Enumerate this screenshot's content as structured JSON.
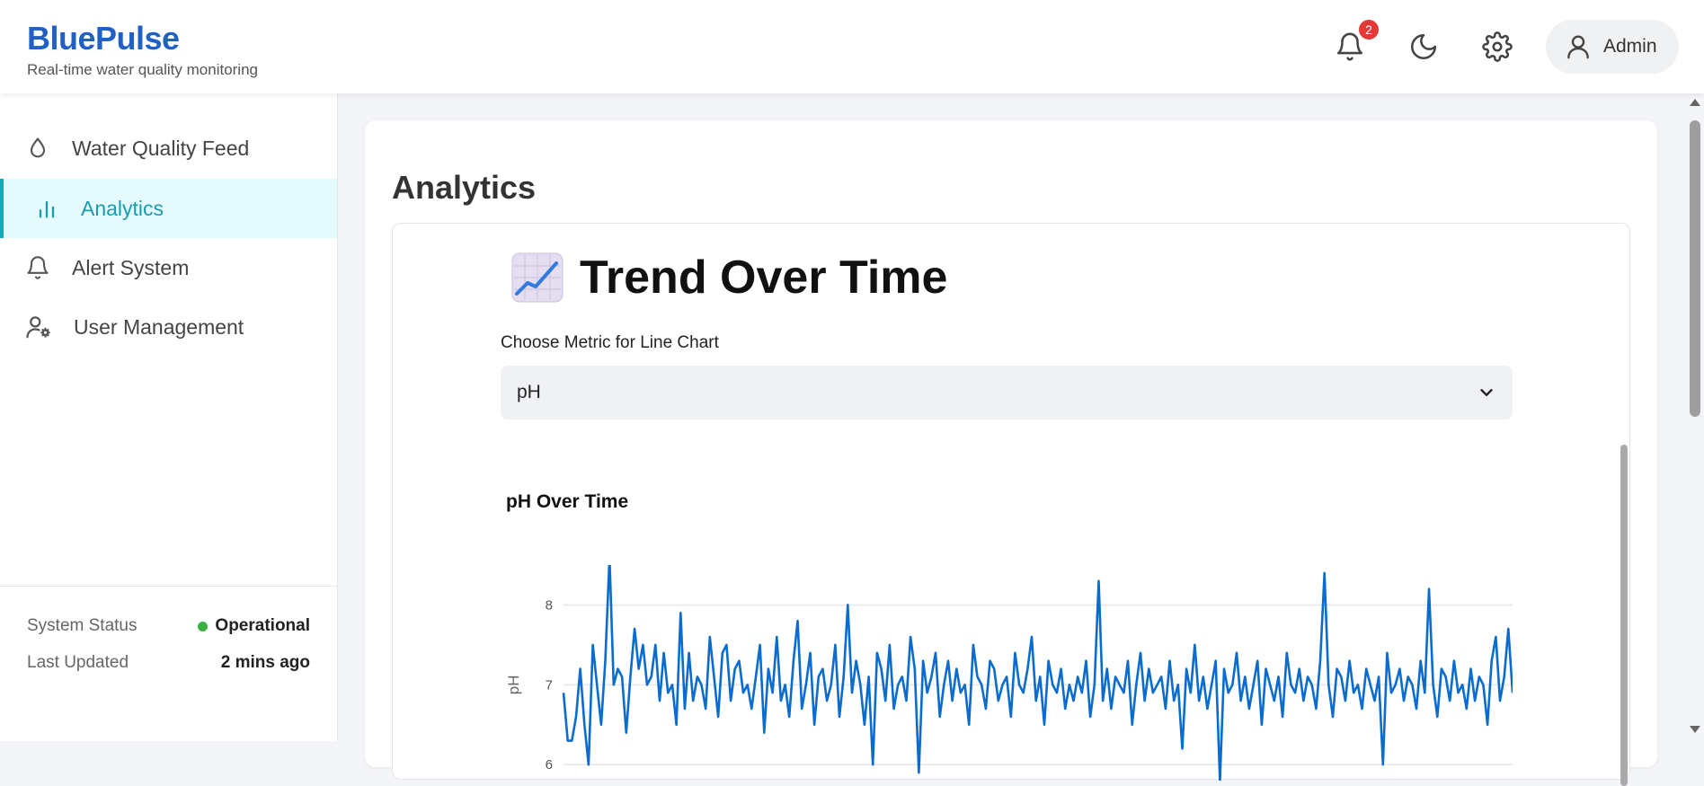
{
  "brand": {
    "name": "BluePulse",
    "tagline": "Real-time water quality monitoring"
  },
  "header": {
    "notification_count": "2",
    "user_name": "Admin",
    "icons": [
      "bell-icon",
      "moon-icon",
      "gear-icon",
      "user-icon"
    ]
  },
  "sidebar": {
    "items": [
      {
        "label": "Water Quality Feed",
        "icon": "droplet-icon",
        "active": false
      },
      {
        "label": "Analytics",
        "icon": "bar-chart-icon",
        "active": true
      },
      {
        "label": "Alert System",
        "icon": "bell-icon",
        "active": false
      },
      {
        "label": "User Management",
        "icon": "user-gear-icon",
        "active": false
      }
    ],
    "status": {
      "system_label": "System Status",
      "system_value": "Operational",
      "updated_label": "Last Updated",
      "updated_value": "2 mins ago"
    }
  },
  "main": {
    "title": "Analytics",
    "trend_heading": "Trend Over Time",
    "metric_label": "Choose Metric for Line Chart",
    "metric_value": "pH"
  },
  "colors": {
    "brand": "#2160c4",
    "accent": "#1aa5b8",
    "line": "#0a6ccf",
    "status_ok": "#3cb043",
    "badge": "#e53935"
  },
  "chart_data": {
    "type": "line",
    "title": "pH Over Time",
    "ylabel": "pH",
    "xlabel": "",
    "ylim": [
      5.8,
      8.5
    ],
    "yticks": [
      6,
      7,
      8
    ],
    "grid": true,
    "series": [
      {
        "values": [
          6.9,
          6.3,
          6.3,
          6.6,
          7.2,
          6.5,
          6.0,
          7.5,
          7.0,
          6.5,
          7.3,
          8.6,
          7.0,
          7.2,
          7.1,
          6.4,
          7.1,
          7.7,
          7.2,
          7.5,
          7.0,
          7.1,
          7.5,
          6.8,
          7.4,
          6.9,
          7.0,
          6.5,
          7.9,
          6.7,
          7.4,
          6.8,
          7.1,
          7.0,
          6.7,
          7.6,
          7.1,
          6.6,
          7.4,
          7.5,
          6.8,
          7.2,
          7.3,
          6.9,
          7.0,
          6.7,
          7.1,
          7.5,
          6.4,
          7.2,
          6.9,
          7.6,
          6.8,
          7.0,
          6.6,
          7.3,
          7.8,
          6.7,
          7.0,
          7.4,
          6.5,
          7.1,
          7.2,
          6.8,
          7.0,
          7.5,
          6.6,
          7.1,
          8.0,
          6.9,
          7.3,
          7.0,
          6.5,
          7.1,
          6.0,
          7.4,
          7.2,
          6.8,
          7.5,
          6.7,
          7.0,
          7.1,
          6.8,
          7.6,
          7.2,
          5.9,
          7.3,
          6.9,
          7.1,
          7.4,
          6.6,
          7.0,
          7.3,
          6.8,
          7.2,
          6.9,
          7.0,
          6.5,
          7.5,
          7.1,
          7.0,
          6.7,
          7.3,
          7.2,
          6.8,
          7.0,
          7.1,
          6.6,
          7.4,
          7.0,
          6.9,
          7.2,
          7.6,
          6.8,
          7.1,
          6.5,
          7.3,
          7.0,
          6.9,
          7.2,
          6.7,
          7.0,
          6.8,
          7.1,
          6.9,
          7.3,
          6.6,
          7.0,
          8.3,
          6.8,
          7.2,
          6.7,
          7.1,
          7.0,
          6.9,
          7.3,
          6.5,
          7.0,
          7.4,
          6.8,
          7.2,
          6.9,
          7.0,
          7.1,
          6.7,
          7.3,
          6.8,
          7.0,
          6.2,
          7.2,
          6.9,
          7.5,
          6.8,
          7.1,
          6.7,
          7.0,
          7.3,
          5.8,
          7.2,
          6.9,
          7.0,
          7.4,
          6.8,
          7.1,
          6.7,
          7.0,
          7.3,
          6.5,
          7.2,
          7.0,
          6.8,
          7.1,
          6.6,
          7.4,
          7.0,
          6.9,
          7.2,
          6.8,
          7.1,
          7.0,
          6.7,
          7.3,
          8.4,
          7.0,
          6.6,
          7.2,
          7.1,
          6.8,
          7.3,
          6.9,
          7.0,
          6.7,
          7.2,
          7.0,
          6.8,
          7.1,
          6.0,
          7.4,
          6.9,
          7.0,
          7.2,
          6.8,
          7.1,
          7.0,
          6.7,
          7.3,
          6.9,
          8.2,
          7.0,
          6.6,
          7.2,
          7.1,
          6.8,
          7.3,
          6.9,
          7.0,
          6.7,
          7.2,
          6.8,
          7.1,
          7.0,
          6.5,
          7.3,
          7.6,
          6.8,
          7.1,
          7.7,
          6.9
        ]
      }
    ]
  }
}
